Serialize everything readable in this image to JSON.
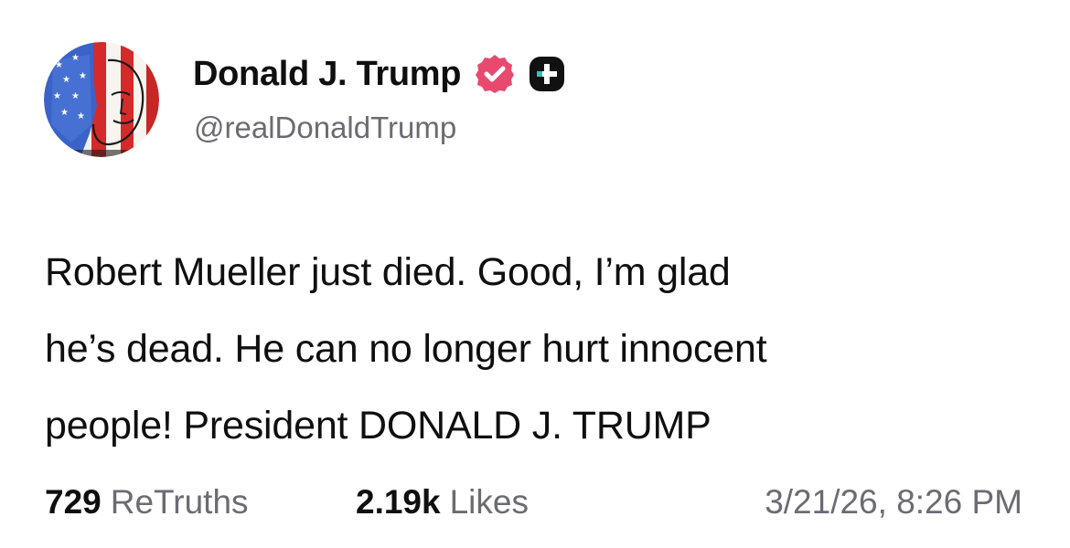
{
  "post": {
    "author": {
      "display_name": "Donald J. Trump",
      "handle": "@realDonaldTrump",
      "avatar_icon": "flag-portrait-avatar",
      "verified_icon": "verified-badge-icon",
      "plus_icon": "plus-badge-icon"
    },
    "body_lines": [
      "Robert Mueller just died. Good, I’m glad",
      "he’s dead. He can no longer hurt innocent",
      "people! President DONALD J. TRUMP"
    ],
    "stats": {
      "retruths_count": "729",
      "retruths_label": "ReTruths",
      "likes_count": "2.19k",
      "likes_label": "Likes"
    },
    "timestamp": "3/21/26, 8:26 PM"
  },
  "colors": {
    "text_primary": "#0f0f10",
    "text_secondary": "#6b6b73",
    "verified_pink": "#e84a6f",
    "plus_dark": "#111111",
    "plus_accent": "#2ec4b6"
  }
}
